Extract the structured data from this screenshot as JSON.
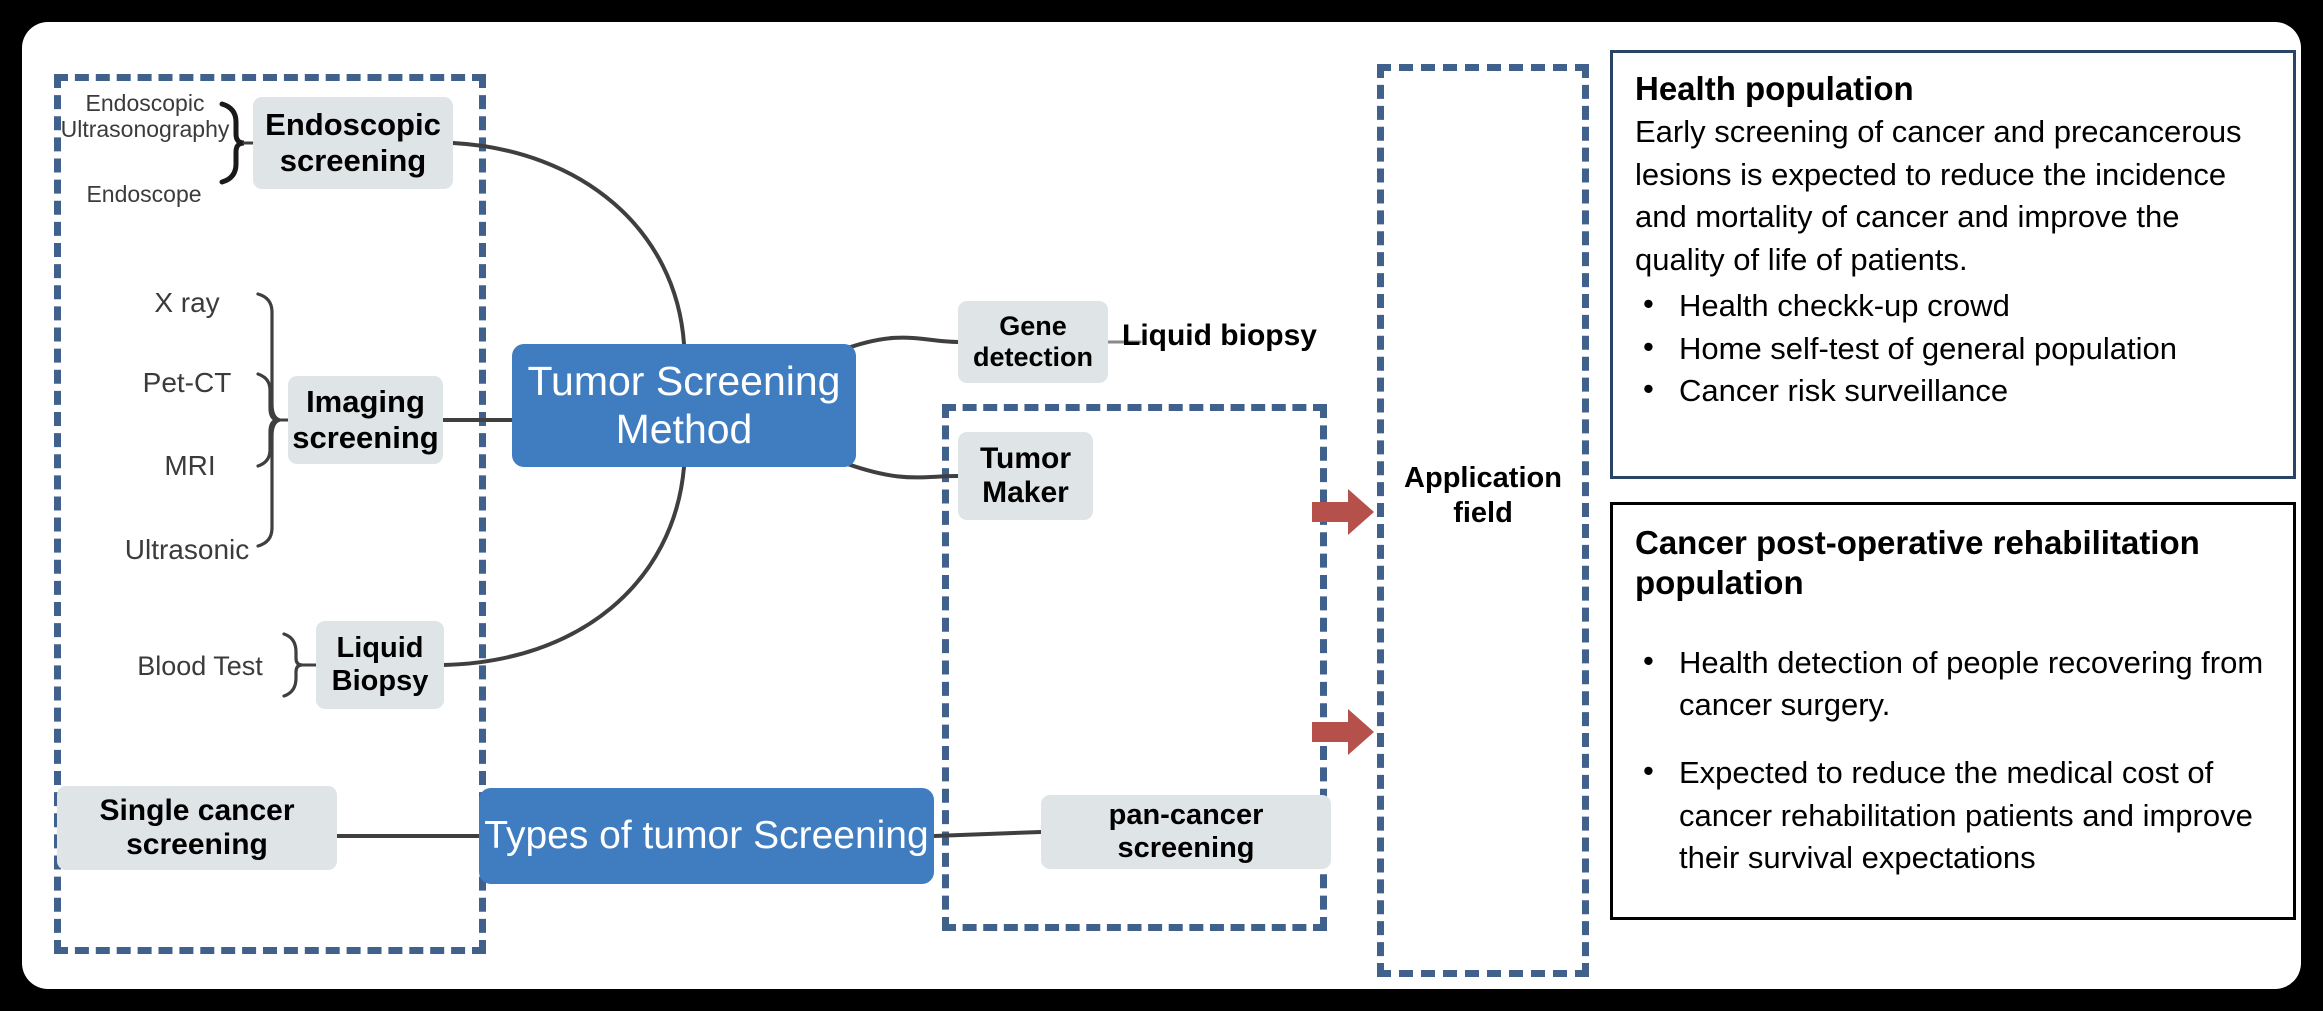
{
  "diagram": {
    "title": "Tumor screening method and application field diagram",
    "colors": {
      "dashed_group_border": "#41618d",
      "primary_node": "#3f7cc0",
      "secondary_node": "#dfe4e6",
      "arrow": "#b5514a",
      "panel_border_blue": "#2a4466",
      "panel_border_black": "#000000",
      "connector_line": "#3f3f3f",
      "page_background": "#ffffff",
      "outer_background": "#000000"
    }
  },
  "left_group": {
    "endoscopic": {
      "node_label": "Endoscopic\nscreening",
      "leaves": [
        {
          "label": "Endoscopic\nUltrasonography"
        },
        {
          "label": "Endoscope"
        }
      ]
    },
    "imaging": {
      "node_label": "Imaging\nscreening",
      "leaves": [
        {
          "label": "X ray"
        },
        {
          "label": "Pet-CT"
        },
        {
          "label": "MRI"
        },
        {
          "label": "Ultrasonic"
        }
      ]
    },
    "liquid_biopsy": {
      "node_label": "Liquid\nBiopsy",
      "leaves": [
        {
          "label": "Blood Test"
        }
      ]
    },
    "single_cancer": {
      "node_label": "Single cancer\nscreening"
    }
  },
  "center": {
    "method_node": "Tumor Screening\nMethod",
    "types_node": "Types of tumor Screening"
  },
  "middle_group": {
    "gene_detection": "Gene\ndetection",
    "liquid_biopsy_label": "Liquid biopsy",
    "tumor_maker": "Tumor\nMaker",
    "pan_cancer": "pan-cancer screening"
  },
  "application": {
    "label": "Application\nfield",
    "arrows": [
      {
        "name": "arrow-to-health-population"
      },
      {
        "name": "arrow-to-rehab-population"
      }
    ]
  },
  "panels": [
    {
      "id": "health-population",
      "title": "Health population",
      "body": "Early screening of cancer and precancerous lesions is expected to reduce the incidence and mortality of cancer and improve the quality of life of patients.",
      "bullets": [
        "Health checkk-up crowd",
        "Home self-test of general population",
        "Cancer risk surveillance"
      ]
    },
    {
      "id": "cancer-post-operative-rehabilitation-population",
      "title": "Cancer post-operative rehabilitation population",
      "body": "",
      "bullets": [
        "Health detection of people recovering from cancer surgery.",
        "Expected to reduce the medical cost of cancer rehabilitation patients and improve their survival expectations"
      ]
    }
  ]
}
